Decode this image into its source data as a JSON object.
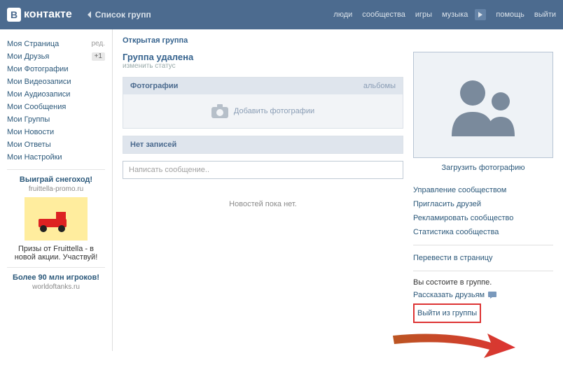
{
  "header": {
    "logo_text": "контакте",
    "back_label": "Список групп",
    "nav": {
      "people": "люди",
      "communities": "сообщества",
      "games": "игры",
      "music": "музыка",
      "help": "помощь",
      "logout": "выйти"
    }
  },
  "sidebar": {
    "items": [
      {
        "label": "Моя Страница",
        "extra": "ред."
      },
      {
        "label": "Мои Друзья",
        "extra": "+1"
      },
      {
        "label": "Мои Фотографии"
      },
      {
        "label": "Мои Видеозаписи"
      },
      {
        "label": "Мои Аудиозаписи"
      },
      {
        "label": "Мои Сообщения"
      },
      {
        "label": "Мои Группы"
      },
      {
        "label": "Мои Новости"
      },
      {
        "label": "Мои Ответы"
      },
      {
        "label": "Мои Настройки"
      }
    ],
    "ads": [
      {
        "title": "Выиграй снегоход!",
        "domain": "fruittella-promo.ru",
        "text": "Призы от Fruittella - в новой акции. Участвуй!"
      },
      {
        "title": "Более 90 млн игроков!",
        "domain": "worldoftanks.ru"
      }
    ]
  },
  "main": {
    "page_head": "Открытая группа",
    "group_title": "Группа удалена",
    "status": "изменить статус",
    "photos_head": "Фотографии",
    "photos_sub": "альбомы",
    "add_photos": "Добавить фотографии",
    "no_posts_head": "Нет записей",
    "input_placeholder": "Написать сообщение..",
    "no_news": "Новостей пока нет.",
    "upload_link": "Загрузить фотографию",
    "manage_links": {
      "manage": "Управление сообществом",
      "invite": "Пригласить друзей",
      "advertise": "Рекламировать сообщество",
      "stats": "Статистика сообщества",
      "convert": "Перевести в страницу"
    },
    "membership": {
      "line": "Вы состоите в группе.",
      "tell": "Рассказать друзьям",
      "leave": "Выйти из группы"
    }
  }
}
